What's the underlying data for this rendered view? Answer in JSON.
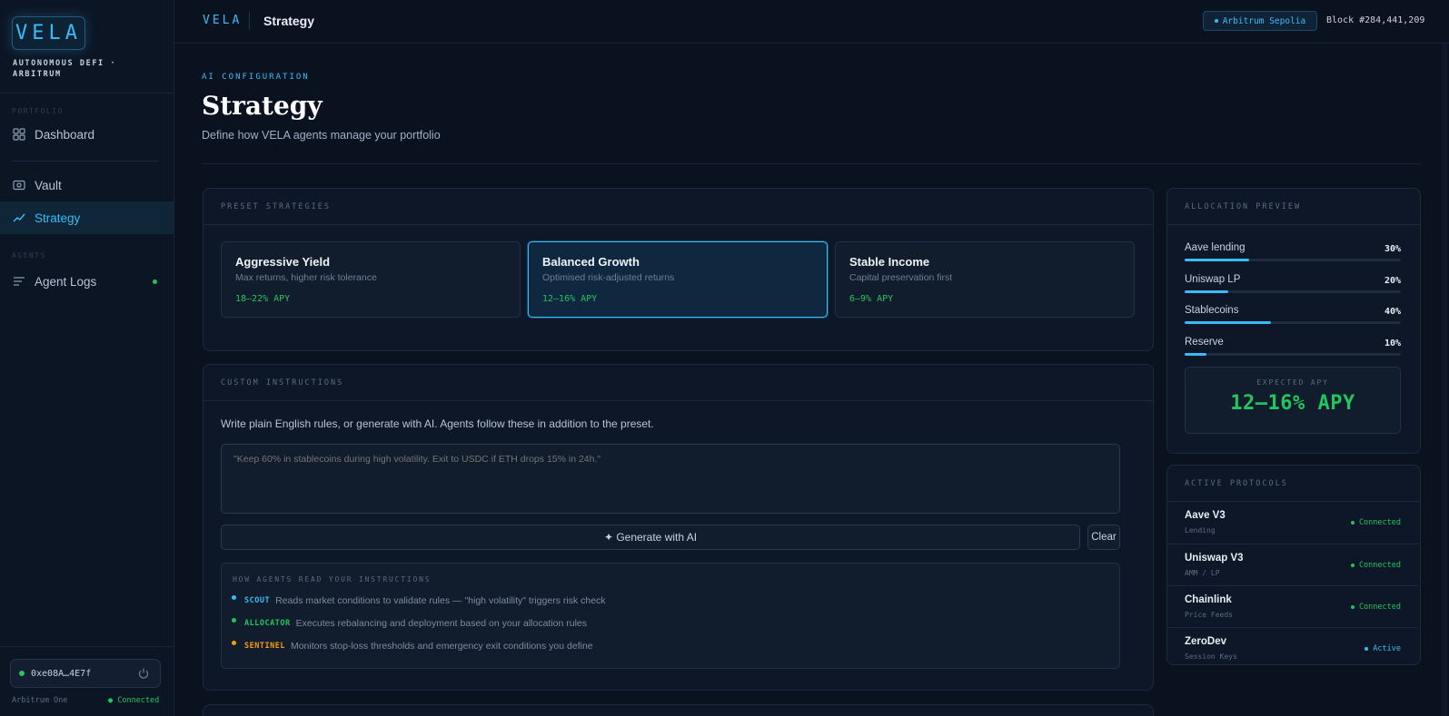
{
  "brand": {
    "logo": "VELA",
    "tagline": "AUTONOMOUS DEFI · ARBITRUM"
  },
  "sidebar": {
    "sections": {
      "portfolio": "PORTFOLIO",
      "agents": "AGENTS"
    },
    "items": [
      {
        "label": "Dashboard",
        "icon": "grid-icon"
      },
      {
        "label": "Vault",
        "icon": "vault-icon"
      },
      {
        "label": "Strategy",
        "icon": "chart-line-icon",
        "active": true
      },
      {
        "label": "Agent Logs",
        "icon": "list-icon",
        "status": "online"
      }
    ],
    "wallet": {
      "address": "0xe08A…4E7f",
      "network": "Arbitrum One",
      "status": "● Connected"
    }
  },
  "topbar": {
    "brand": "VELA",
    "title": "Strategy",
    "network": "Arbitrum Sepolia",
    "block": "Block #284,441,209"
  },
  "header": {
    "eyebrow": "AI CONFIGURATION",
    "title": "Strategy",
    "subtitle": "Define how VELA agents manage your portfolio"
  },
  "presets": {
    "title": "PRESET STRATEGIES",
    "items": [
      {
        "name": "Aggressive Yield",
        "desc": "Max returns, higher risk tolerance",
        "apy": "18–22% APY"
      },
      {
        "name": "Balanced Growth",
        "desc": "Optimised risk-adjusted returns",
        "apy": "12–16% APY",
        "selected": true
      },
      {
        "name": "Stable Income",
        "desc": "Capital preservation first",
        "apy": "6–9% APY"
      }
    ]
  },
  "custom": {
    "title": "CUSTOM INSTRUCTIONS",
    "help": "Write plain English rules, or generate with AI. Agents follow these in addition to the preset.",
    "placeholder": "\"Keep 60% in stablecoins during high volatility. Exit to USDC if ETH drops 15% in 24h.\"",
    "generate_label": "✦ Generate with AI",
    "clear_label": "Clear",
    "howto_title": "HOW AGENTS READ YOUR INSTRUCTIONS",
    "agents": [
      {
        "name": "SCOUT",
        "desc": "Reads market conditions to validate rules — \"high volatility\" triggers risk check",
        "color": "#38bdf8"
      },
      {
        "name": "ALLOCATOR",
        "desc": "Executes rebalancing and deployment based on your allocation rules",
        "color": "#22c55e"
      },
      {
        "name": "SENTINEL",
        "desc": "Monitors stop-loss thresholds and emergency exit conditions you define",
        "color": "#f59e0b"
      }
    ]
  },
  "allocation": {
    "title": "ALLOCATION PREVIEW",
    "items": [
      {
        "label": "Aave lending",
        "value": "30%",
        "pct": 30
      },
      {
        "label": "Uniswap LP",
        "value": "20%",
        "pct": 20
      },
      {
        "label": "Stablecoins",
        "value": "40%",
        "pct": 40
      },
      {
        "label": "Reserve",
        "value": "10%",
        "pct": 10
      }
    ],
    "expected_label": "EXPECTED APY",
    "expected_value": "12–16% APY"
  },
  "protocols": {
    "title": "ACTIVE PROTOCOLS",
    "items": [
      {
        "name": "Aave V3",
        "sub": "Lending",
        "status": "Connected",
        "color": "#22c55e"
      },
      {
        "name": "Uniswap V3",
        "sub": "AMM / LP",
        "status": "Connected",
        "color": "#22c55e"
      },
      {
        "name": "Chainlink",
        "sub": "Price Feeds",
        "status": "Connected",
        "color": "#22c55e"
      },
      {
        "name": "ZeroDev",
        "sub": "Session Keys",
        "status": "Active",
        "color": "#38bdf8"
      }
    ]
  }
}
